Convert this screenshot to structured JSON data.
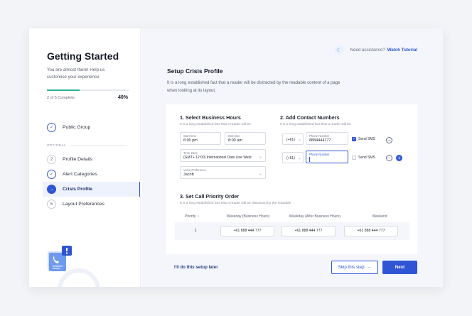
{
  "sidebar": {
    "title": "Getting Started",
    "subtitle": "You are almost there! Help us customise your experience",
    "progress_label": "2 of 5 Complete",
    "progress_percent": "40%",
    "progress_fraction": 0.4,
    "optional_label": "OPTIONAL",
    "steps": [
      {
        "number": "",
        "label": "Public Group",
        "state": "done"
      },
      {
        "number": "2",
        "label": "Profile Details",
        "state": "todo"
      },
      {
        "number": "",
        "label": "Alert Categories",
        "state": "done"
      },
      {
        "number": "",
        "label": "Crisis Profile",
        "state": "active"
      },
      {
        "number": "5",
        "label": "Layout Preferences",
        "state": "todo"
      }
    ]
  },
  "help": {
    "question": "Need assistance?",
    "link": "Watch Tutorial"
  },
  "main": {
    "title": "Setup Crisis Profile",
    "description": "It is a long established fact that a reader will be distracted by the readable content of a page when looking at its layout."
  },
  "business_hours": {
    "title": "1. Select Business Hours",
    "subtitle": "It is a long established fact that a reader will be",
    "start_label": "Start time",
    "start_value": "6:00 pm",
    "end_label": "End time",
    "end_value": "8:00 am",
    "timezone_label": "Time Zone",
    "timezone_value": "(GMT+ 12:00) International Date Line West",
    "voice_label": "Voice Preference",
    "voice_value": "Jacob"
  },
  "contacts": {
    "title": "2. Add Contact Numbers",
    "subtitle": "It is a long established fact that a reader will be",
    "rows": [
      {
        "code": "(+61)",
        "phone_label": "Phone Number",
        "phone_value": "8884444777",
        "sms_label": "Send SMS",
        "sms_checked": true
      },
      {
        "code": "(+61)",
        "phone_label": "Phone Number",
        "phone_value": "",
        "sms_label": "Send SMS",
        "sms_checked": false
      }
    ]
  },
  "priority": {
    "title": "3. Set Call Priority Order",
    "subtitle": "It is a long established fact that a reader will be distracted by the readable",
    "columns": [
      "Priority",
      "Weekday (Business Hours)",
      "Weekday (After Business Hours)",
      "Weekend"
    ],
    "sort_icon": "arrow-down-icon",
    "rows": [
      {
        "priority": "1",
        "weekday_business": "+61 888 444 777",
        "weekday_after": "+61 888 444 777",
        "weekend": "+61 888 444 777"
      }
    ]
  },
  "footer": {
    "later": "I'll do this setup later",
    "skip": "Skip this step",
    "next": "Next"
  },
  "colors": {
    "primary": "#2f55d4",
    "progress": "#2bb39a",
    "background": "#f3f4f7"
  }
}
